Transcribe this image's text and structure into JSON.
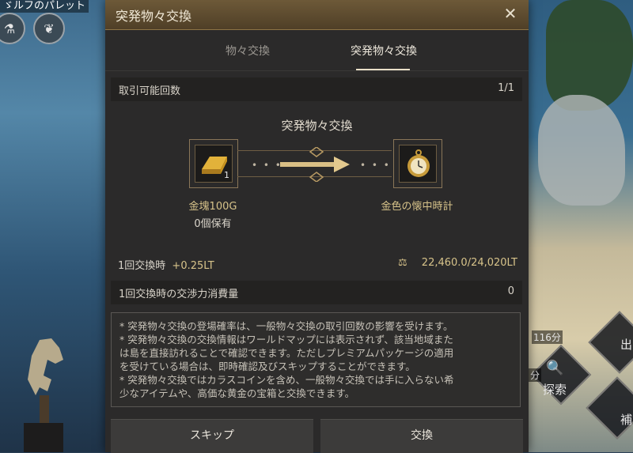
{
  "background": {
    "top_left_text": "ゞルフのパレット",
    "top_left_icons": [
      "flask-icon",
      "fish-icon"
    ],
    "right_panel": {
      "time_left": "116分",
      "time_left2": "分",
      "explore_label": "探索",
      "button_top_label": "出",
      "button_bottom_label": "補"
    }
  },
  "modal": {
    "title": "突発物々交換",
    "close_icon": "close-icon",
    "tabs": [
      {
        "label": "物々交換",
        "active": false
      },
      {
        "label": "突発物々交換",
        "active": true
      }
    ],
    "trade_count": {
      "label": "取引可能回数",
      "value": "1/1"
    },
    "exchange": {
      "heading": "突発物々交換",
      "give_item": {
        "icon": "gold-bar-icon",
        "quantity": "1",
        "name": "金塊100G",
        "owned": "0個保有"
      },
      "get_item": {
        "icon": "pocket-watch-icon",
        "name": "金色の懐中時計"
      },
      "arrow_icon": "arrow-right-icon",
      "dots": "• • •"
    },
    "lt_info": {
      "label": "1回交換時",
      "value": "+0.25LT",
      "weight_icon": "weight-icon",
      "weight": "22,460.0/24,020LT"
    },
    "energy": {
      "label": "1回交換時の交渉力消費量",
      "value": "0"
    },
    "notes": [
      "* 突発物々交換の登場確率は、一般物々交換の取引回数の影響を受けます。",
      "* 突発物々交換の交換情報はワールドマップには表示されず、該当地域また",
      "は島を直接訪れることで確認できます。ただしプレミアムパッケージの適用",
      "を受けている場合は、即時確認及びスキップすることができます。",
      "* 突発物々交換ではカラスコインを含め、一般物々交換では手に入らない希",
      "少なアイテムや、高価な黄金の宝箱と交換できます。"
    ],
    "buttons": {
      "skip": "スキップ",
      "exchange": "交換"
    }
  },
  "colors": {
    "title_bar": "#5d4b30",
    "accent_gold": "#d7c38a",
    "panel_bg": "#2b2a2a"
  }
}
